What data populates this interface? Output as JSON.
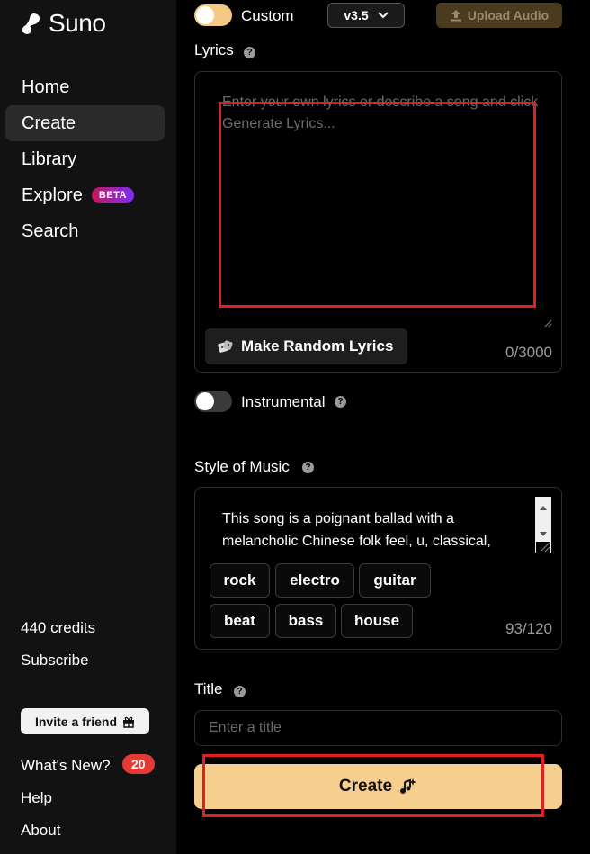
{
  "app": {
    "name": "Suno"
  },
  "sidebar": {
    "nav": [
      {
        "label": "Home"
      },
      {
        "label": "Create"
      },
      {
        "label": "Library"
      },
      {
        "label": "Explore",
        "badge": "BETA"
      },
      {
        "label": "Search"
      }
    ],
    "credits": "440 credits",
    "subscribe": "Subscribe",
    "invite": "Invite a friend",
    "whats_new": "What's New?",
    "whats_new_count": "20",
    "help": "Help",
    "about": "About"
  },
  "form": {
    "custom_label": "Custom",
    "custom_enabled": true,
    "version": "v3.5",
    "upload_audio": "Upload Audio",
    "lyrics_label": "Lyrics",
    "lyrics_placeholder": "Enter your own lyrics or describe a song and click Generate Lyrics...",
    "random_lyrics": "Make Random Lyrics",
    "lyrics_counter": "0/3000",
    "instrumental_label": "Instrumental",
    "instrumental_enabled": false,
    "style_label": "Style of Music",
    "style_value": "This song is a poignant ballad with a melancholic Chinese folk feel, u, classical,",
    "style_tags": [
      "rock",
      "electro",
      "guitar",
      "beat",
      "bass",
      "house"
    ],
    "style_counter": "93/120",
    "title_label": "Title",
    "title_placeholder": "Enter a title",
    "create_button": "Create"
  },
  "colors": {
    "accent": "#f6cf8e",
    "sidebar_bg": "#121212",
    "highlight": "#e02020"
  }
}
